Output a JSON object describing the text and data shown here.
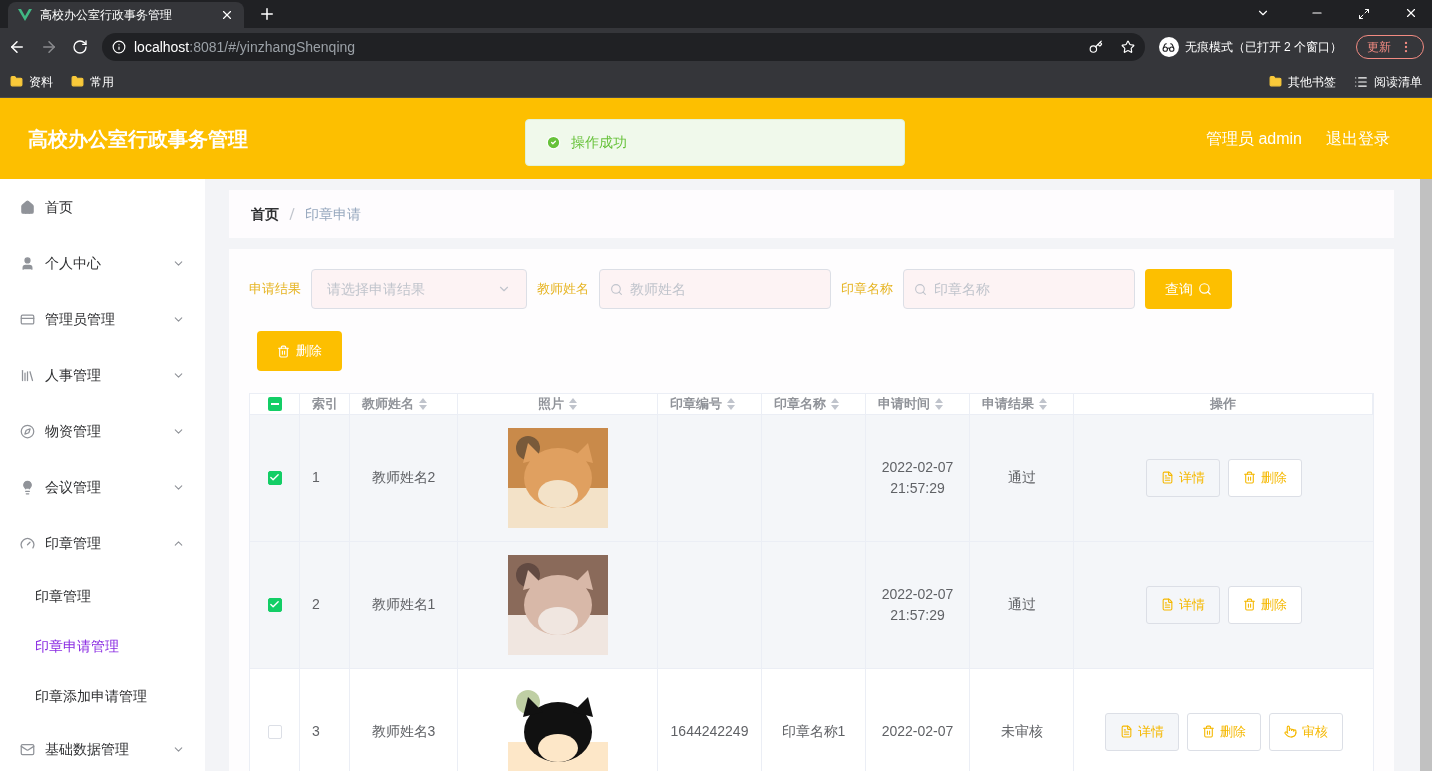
{
  "browser": {
    "tab_title": "高校办公室行政事务管理",
    "url": {
      "host": "localhost",
      "path": ":8081/#/yinzhangShenqing"
    },
    "incognito": "无痕模式（已打开 2 个窗口）",
    "update": "更新",
    "bookmarks": [
      "资料",
      "常用"
    ],
    "right_bookmarks": [
      {
        "kind": "folder",
        "label": "其他书签"
      },
      {
        "kind": "list",
        "label": "阅读清单"
      }
    ]
  },
  "header": {
    "title": "高校办公室行政事务管理",
    "toast": "操作成功",
    "user": "管理员 admin",
    "logout": "退出登录"
  },
  "sidebar": {
    "items": [
      {
        "kind": "link",
        "label": "首页"
      },
      {
        "kind": "submenu",
        "label": "个人中心",
        "expanded": false
      },
      {
        "kind": "submenu",
        "label": "管理员管理",
        "expanded": false
      },
      {
        "kind": "submenu",
        "label": "人事管理",
        "expanded": false
      },
      {
        "kind": "submenu",
        "label": "物资管理",
        "expanded": false
      },
      {
        "kind": "submenu",
        "label": "会议管理",
        "expanded": false
      },
      {
        "kind": "submenu",
        "label": "印章管理",
        "expanded": true,
        "children": [
          {
            "label": "印章管理",
            "selected": false
          },
          {
            "label": "印章申请管理",
            "selected": true
          },
          {
            "label": "印章添加申请管理",
            "selected": false
          }
        ]
      },
      {
        "kind": "submenu",
        "label": "基础数据管理",
        "expanded": false
      }
    ]
  },
  "breadcrumb": [
    "首页",
    "印章申请"
  ],
  "filters": [
    {
      "kind": "select",
      "label": "申请结果",
      "placeholder": "请选择申请结果"
    },
    {
      "kind": "search",
      "label": "教师姓名",
      "placeholder": "教师姓名"
    },
    {
      "kind": "search",
      "label": "印章名称",
      "placeholder": "印章名称"
    }
  ],
  "query_button": "查询",
  "delete_button": "删除",
  "table": {
    "select_all": {
      "indeterminate": true
    },
    "columns": [
      {
        "label": "索引",
        "sortable": false
      },
      {
        "label": "教师姓名",
        "sortable": true
      },
      {
        "label": "照片",
        "sortable": true
      },
      {
        "label": "印章编号",
        "sortable": true
      },
      {
        "label": "印章名称",
        "sortable": true
      },
      {
        "label": "申请时间",
        "sortable": true
      },
      {
        "label": "申请结果",
        "sortable": true
      },
      {
        "label": "操作",
        "sortable": false
      }
    ],
    "rows": [
      {
        "checked": true,
        "index": "1",
        "teacher": "教师姓名2",
        "photo": {
          "kind": "picture"
        },
        "seal_no": "",
        "seal_name": "",
        "time": "2022-02-07 21:57:29",
        "result": "通过",
        "actions": [
          {
            "kind": "detail",
            "label": "详情"
          },
          {
            "kind": "delete",
            "label": "删除"
          }
        ]
      },
      {
        "checked": true,
        "index": "2",
        "teacher": "教师姓名1",
        "photo": {
          "kind": "picture"
        },
        "seal_no": "",
        "seal_name": "",
        "time": "2022-02-07 21:57:29",
        "result": "通过",
        "actions": [
          {
            "kind": "detail",
            "label": "详情"
          },
          {
            "kind": "delete",
            "label": "删除"
          }
        ]
      },
      {
        "checked": false,
        "index": "3",
        "teacher": "教师姓名3",
        "photo": {
          "kind": "picture"
        },
        "seal_no": "1644242249",
        "seal_name": "印章名称1",
        "time": "2022-02-07",
        "result": "未审核",
        "actions": [
          {
            "kind": "detail",
            "label": "详情"
          },
          {
            "kind": "delete",
            "label": "删除"
          },
          {
            "kind": "review",
            "label": "审核"
          }
        ]
      }
    ]
  }
}
